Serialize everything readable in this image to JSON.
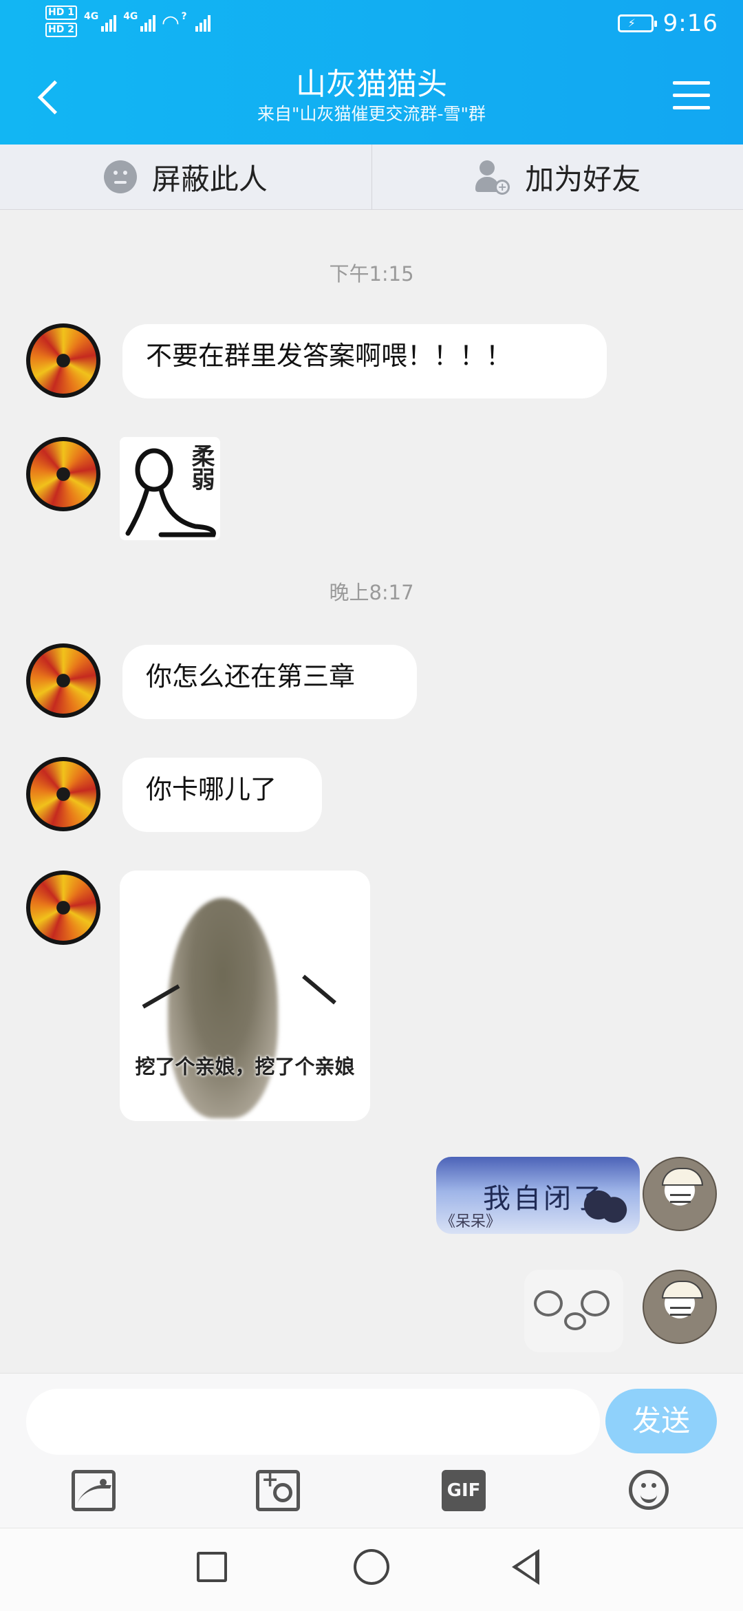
{
  "status_bar": {
    "hd1": "HD 1",
    "hd2": "HD 2",
    "net1": "4G",
    "net2": "4G",
    "wifi": "?",
    "time": "9:16"
  },
  "header": {
    "title": "山灰猫猫头",
    "subtitle": "来自\"山灰猫催更交流群-雪\"群"
  },
  "actions": {
    "block_label": "屏蔽此人",
    "add_friend_label": "加为好友"
  },
  "messages": [
    {
      "type": "time",
      "text": "下午1:15"
    },
    {
      "type": "text",
      "from": "other",
      "text": "不要在群里发答案啊喂！！！！"
    },
    {
      "type": "sticker",
      "from": "other",
      "text": "柔弱"
    },
    {
      "type": "time",
      "text": "晚上8:17"
    },
    {
      "type": "text",
      "from": "other",
      "text": "你怎么还在第三章"
    },
    {
      "type": "text",
      "from": "other",
      "text": "你卡哪儿了"
    },
    {
      "type": "sticker",
      "from": "other",
      "text": "挖了个亲娘，挖了个亲娘"
    },
    {
      "type": "image",
      "from": "me",
      "text": "我自闭了",
      "tag": "《呆呆》"
    },
    {
      "type": "sticker",
      "from": "me",
      "text": ""
    }
  ],
  "input": {
    "value": "",
    "placeholder": "",
    "send_label": "发送"
  },
  "toolbar": {
    "gif_label": "GIF"
  }
}
